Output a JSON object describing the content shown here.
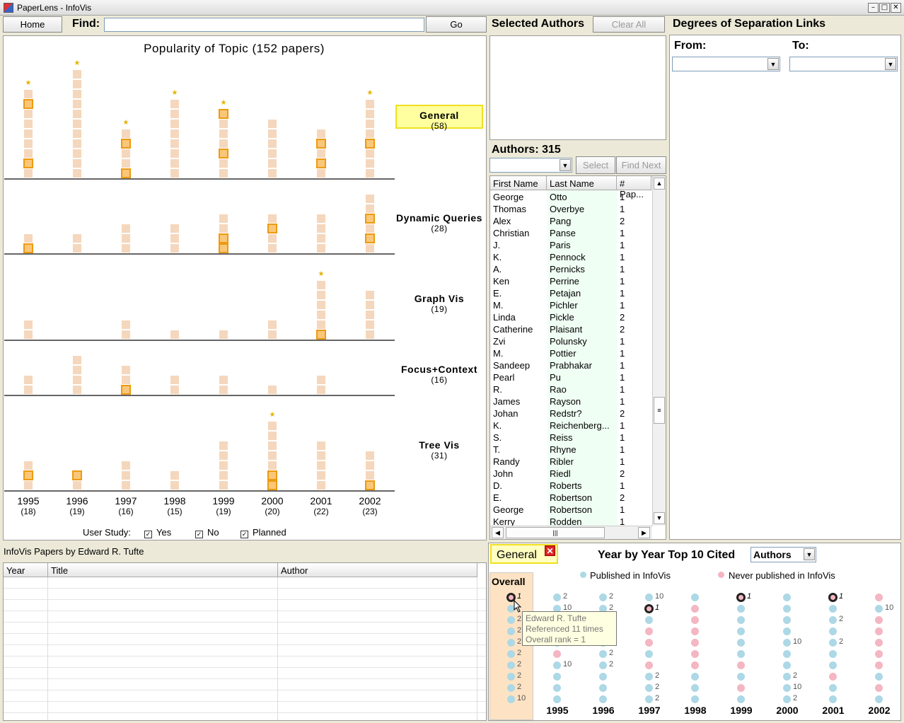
{
  "window": {
    "title": "PaperLens - InfoVis"
  },
  "toolbar": {
    "home_label": "Home",
    "find_label": "Find:",
    "find_value": "",
    "go_label": "Go"
  },
  "popularity": {
    "title": "Popularity of Topic (152 papers)",
    "years": [
      {
        "year": "1995",
        "count": "(18)"
      },
      {
        "year": "1996",
        "count": "(19)"
      },
      {
        "year": "1997",
        "count": "(16)"
      },
      {
        "year": "1998",
        "count": "(15)"
      },
      {
        "year": "1999",
        "count": "(19)"
      },
      {
        "year": "2000",
        "count": "(20)"
      },
      {
        "year": "2001",
        "count": "(22)"
      },
      {
        "year": "2002",
        "count": "(23)"
      }
    ],
    "topics": [
      {
        "name": "General",
        "count": "(58)",
        "selected": true,
        "bars": [
          9,
          11,
          5,
          8,
          7,
          6,
          5,
          8
        ],
        "highlight": [
          [
            1,
            7
          ],
          [],
          [
            0,
            3
          ],
          [],
          [
            2,
            6
          ],
          [],
          [
            1,
            3
          ],
          [
            3
          ]
        ],
        "stars": [
          true,
          true,
          true,
          true,
          true,
          false,
          false,
          true
        ]
      },
      {
        "name": "Dynamic Queries",
        "count": "(28)",
        "selected": false,
        "bars": [
          2,
          2,
          3,
          3,
          4,
          4,
          4,
          6
        ],
        "highlight": [
          [
            0
          ],
          [],
          [],
          [],
          [
            0,
            1
          ],
          [
            2
          ],
          [],
          [
            1,
            3
          ]
        ],
        "stars": [
          false,
          false,
          false,
          false,
          false,
          false,
          false,
          false
        ]
      },
      {
        "name": "Graph Vis",
        "count": "(19)",
        "selected": false,
        "bars": [
          2,
          0,
          2,
          1,
          1,
          2,
          6,
          5
        ],
        "highlight": [
          [],
          [],
          [],
          [],
          [],
          [],
          [
            0
          ],
          []
        ],
        "stars": [
          false,
          false,
          false,
          false,
          false,
          false,
          true,
          false
        ]
      },
      {
        "name": "Focus+Context",
        "count": "(16)",
        "selected": false,
        "bars": [
          2,
          4,
          3,
          2,
          2,
          1,
          2,
          0
        ],
        "highlight": [
          [],
          [],
          [
            0
          ],
          [],
          [],
          [],
          [],
          []
        ],
        "stars": [
          false,
          false,
          false,
          false,
          false,
          false,
          false,
          false
        ]
      },
      {
        "name": "Tree Vis",
        "count": "(31)",
        "selected": false,
        "bars": [
          3,
          2,
          3,
          2,
          5,
          7,
          5,
          4
        ],
        "highlight": [
          [
            1
          ],
          [
            1
          ],
          [],
          [],
          [],
          [
            0,
            1
          ],
          [],
          [
            0
          ]
        ],
        "stars": [
          false,
          false,
          false,
          false,
          false,
          true,
          false,
          false
        ]
      }
    ],
    "user_study_label": "User Study:",
    "filters": [
      {
        "label": "Yes",
        "checked": true
      },
      {
        "label": "No",
        "checked": true
      },
      {
        "label": "Planned",
        "checked": true
      }
    ]
  },
  "selected_authors": {
    "title": "Selected Authors",
    "clear_label": "Clear All"
  },
  "degrees": {
    "title": "Degrees of Separation Links",
    "from_label": "From:",
    "to_label": "To:"
  },
  "authors": {
    "title": "Authors: 315",
    "select_label": "Select",
    "find_next_label": "Find Next",
    "columns": [
      "First Name",
      "Last Name",
      "# Pap..."
    ],
    "rows": [
      [
        "George",
        "Otto",
        "1"
      ],
      [
        "Thomas",
        "Overbye",
        "1"
      ],
      [
        "Alex",
        "Pang",
        "2"
      ],
      [
        "Christian",
        "Panse",
        "1"
      ],
      [
        "J.",
        "Paris",
        "1"
      ],
      [
        "K.",
        "Pennock",
        "1"
      ],
      [
        "A.",
        "Pernicks",
        "1"
      ],
      [
        "Ken",
        "Perrine",
        "1"
      ],
      [
        "E.",
        "Petajan",
        "1"
      ],
      [
        "M.",
        "Pichler",
        "1"
      ],
      [
        "Linda",
        "Pickle",
        "2"
      ],
      [
        "Catherine",
        "Plaisant",
        "2"
      ],
      [
        "Zvi",
        "Polunsky",
        "1"
      ],
      [
        "M.",
        "Pottier",
        "1"
      ],
      [
        "Sandeep",
        "Prabhakar",
        "1"
      ],
      [
        "Pearl",
        "Pu",
        "1"
      ],
      [
        "R.",
        "Rao",
        "1"
      ],
      [
        "James",
        "Rayson",
        "1"
      ],
      [
        "Johan",
        "Redstr?",
        "2"
      ],
      [
        "K.",
        "Reichenberg...",
        "1"
      ],
      [
        "S.",
        "Reiss",
        "1"
      ],
      [
        "T.",
        "Rhyne",
        "1"
      ],
      [
        "Randy",
        "Ribler",
        "1"
      ],
      [
        "John",
        "Riedl",
        "2"
      ],
      [
        "D.",
        "Roberts",
        "1"
      ],
      [
        "E.",
        "Robertson",
        "2"
      ],
      [
        "George",
        "Robertson",
        "1"
      ],
      [
        "Kerry",
        "Rodden",
        "1"
      ]
    ]
  },
  "papers": {
    "title": "InfoVis Papers by Edward R. Tufte",
    "columns": [
      "Year",
      "Title",
      "Author"
    ]
  },
  "cited": {
    "topic": "General",
    "close_icon": "close-icon",
    "title": "Year by Year Top 10 Cited",
    "dropdown_value": "Authors",
    "legend_published": "Published in InfoVis",
    "legend_never": "Never published in InfoVis",
    "overall_label": "Overall",
    "colors": {
      "published": "#add8e6",
      "never": "#f4b6c2"
    },
    "tooltip": [
      "Edward R. Tufte",
      "Referenced 11 times",
      "Overall rank = 1"
    ],
    "columns": [
      {
        "year": "",
        "dots": [
          {
            "c": "h",
            "label": "1",
            "italic": true
          },
          {
            "c": "b",
            "label": ""
          },
          {
            "c": "b",
            "label": "2"
          },
          {
            "c": "b",
            "label": "2"
          },
          {
            "c": "b",
            "label": "2"
          },
          {
            "c": "b",
            "label": "2"
          },
          {
            "c": "b",
            "label": "2"
          },
          {
            "c": "b",
            "label": "2"
          },
          {
            "c": "b",
            "label": "2"
          },
          {
            "c": "b",
            "label": "10"
          }
        ]
      },
      {
        "year": "1995",
        "dots": [
          {
            "c": "b",
            "label": "2"
          },
          {
            "c": "b",
            "label": "10"
          },
          {
            "c": "b",
            "label": ""
          },
          {
            "c": "b",
            "label": ""
          },
          {
            "c": "b",
            "label": ""
          },
          {
            "c": "p",
            "label": ""
          },
          {
            "c": "b",
            "label": "10"
          },
          {
            "c": "b",
            "label": ""
          },
          {
            "c": "b",
            "label": ""
          },
          {
            "c": "b",
            "label": ""
          }
        ]
      },
      {
        "year": "1996",
        "dots": [
          {
            "c": "b",
            "label": "2"
          },
          {
            "c": "b",
            "label": "2"
          },
          {
            "c": "b",
            "label": ""
          },
          {
            "c": "b",
            "label": ""
          },
          {
            "c": "b",
            "label": ""
          },
          {
            "c": "b",
            "label": "2"
          },
          {
            "c": "b",
            "label": "2"
          },
          {
            "c": "b",
            "label": ""
          },
          {
            "c": "b",
            "label": ""
          },
          {
            "c": "b",
            "label": ""
          }
        ]
      },
      {
        "year": "1997",
        "dots": [
          {
            "c": "b",
            "label": "10"
          },
          {
            "c": "h",
            "label": "1",
            "italic": true
          },
          {
            "c": "b",
            "label": ""
          },
          {
            "c": "p",
            "label": ""
          },
          {
            "c": "p",
            "label": ""
          },
          {
            "c": "b",
            "label": ""
          },
          {
            "c": "p",
            "label": ""
          },
          {
            "c": "b",
            "label": "2"
          },
          {
            "c": "b",
            "label": "2"
          },
          {
            "c": "b",
            "label": "2"
          }
        ]
      },
      {
        "year": "1998",
        "dots": [
          {
            "c": "b",
            "label": ""
          },
          {
            "c": "p",
            "label": ""
          },
          {
            "c": "p",
            "label": ""
          },
          {
            "c": "p",
            "label": ""
          },
          {
            "c": "p",
            "label": ""
          },
          {
            "c": "p",
            "label": ""
          },
          {
            "c": "p",
            "label": ""
          },
          {
            "c": "b",
            "label": ""
          },
          {
            "c": "b",
            "label": ""
          },
          {
            "c": "b",
            "label": ""
          }
        ]
      },
      {
        "year": "1999",
        "dots": [
          {
            "c": "h",
            "label": "1",
            "italic": true
          },
          {
            "c": "b",
            "label": ""
          },
          {
            "c": "b",
            "label": ""
          },
          {
            "c": "b",
            "label": ""
          },
          {
            "c": "b",
            "label": ""
          },
          {
            "c": "b",
            "label": ""
          },
          {
            "c": "p",
            "label": ""
          },
          {
            "c": "b",
            "label": ""
          },
          {
            "c": "p",
            "label": ""
          },
          {
            "c": "b",
            "label": ""
          }
        ]
      },
      {
        "year": "2000",
        "dots": [
          {
            "c": "b",
            "label": ""
          },
          {
            "c": "b",
            "label": ""
          },
          {
            "c": "b",
            "label": ""
          },
          {
            "c": "b",
            "label": ""
          },
          {
            "c": "b",
            "label": "10"
          },
          {
            "c": "b",
            "label": ""
          },
          {
            "c": "b",
            "label": ""
          },
          {
            "c": "b",
            "label": "2"
          },
          {
            "c": "b",
            "label": "10"
          },
          {
            "c": "b",
            "label": "2"
          }
        ]
      },
      {
        "year": "2001",
        "dots": [
          {
            "c": "h",
            "label": "1",
            "italic": true
          },
          {
            "c": "b",
            "label": ""
          },
          {
            "c": "b",
            "label": "2"
          },
          {
            "c": "b",
            "label": ""
          },
          {
            "c": "b",
            "label": "2"
          },
          {
            "c": "b",
            "label": ""
          },
          {
            "c": "b",
            "label": ""
          },
          {
            "c": "p",
            "label": ""
          },
          {
            "c": "b",
            "label": ""
          },
          {
            "c": "b",
            "label": ""
          }
        ]
      },
      {
        "year": "2002",
        "dots": [
          {
            "c": "p",
            "label": ""
          },
          {
            "c": "b",
            "label": "10"
          },
          {
            "c": "p",
            "label": ""
          },
          {
            "c": "p",
            "label": ""
          },
          {
            "c": "p",
            "label": ""
          },
          {
            "c": "p",
            "label": ""
          },
          {
            "c": "p",
            "label": ""
          },
          {
            "c": "b",
            "label": ""
          },
          {
            "c": "p",
            "label": ""
          },
          {
            "c": "b",
            "label": ""
          }
        ]
      }
    ]
  }
}
